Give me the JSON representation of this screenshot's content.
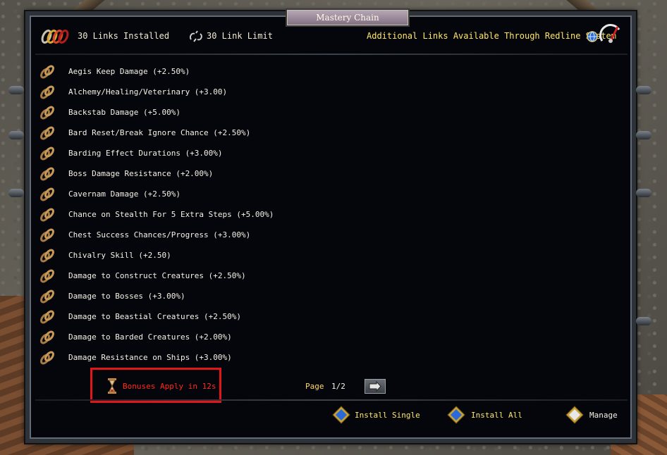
{
  "window": {
    "title": "Mastery Chain"
  },
  "header": {
    "links_installed": "30 Links Installed",
    "link_limit": "30 Link Limit",
    "additional_info": "Additional Links Available Through Redline System"
  },
  "bonuses": [
    "Aegis Keep Damage (+2.50%)",
    "Alchemy/Healing/Veterinary (+3.00)",
    "Backstab Damage (+5.00%)",
    "Bard Reset/Break Ignore Chance (+2.50%)",
    "Barding Effect Durations (+3.00%)",
    "Boss Damage Resistance (+2.00%)",
    "Cavernam Damage (+2.50%)",
    "Chance on Stealth For 5 Extra Steps (+5.00%)",
    "Chest Success Chances/Progress (+3.00%)",
    "Chivalry Skill (+2.50)",
    "Damage to Construct Creatures (+2.50%)",
    "Damage to Bosses (+3.00%)",
    "Damage to Beastial Creatures (+2.50%)",
    "Damage to Barded Creatures (+2.00%)",
    "Damage Resistance on Ships (+3.00%)"
  ],
  "status": {
    "bonuses_apply": "Bonuses Apply in 12s"
  },
  "pagination": {
    "label": "Page",
    "value": "1/2"
  },
  "footer": {
    "install_single": "Install Single",
    "install_all": "Install All",
    "manage": "Manage"
  },
  "colors": {
    "accent_yellow": "#ffe766",
    "alert_red": "#ff2a1a",
    "highlight_box": "#e0161a"
  },
  "icons": [
    "chain-link-icon",
    "broken-chain-icon",
    "hourglass-icon",
    "next-page-arrow-icon",
    "blue-gem-icon",
    "white-gem-icon",
    "gauge-icon",
    "globe-icon"
  ]
}
